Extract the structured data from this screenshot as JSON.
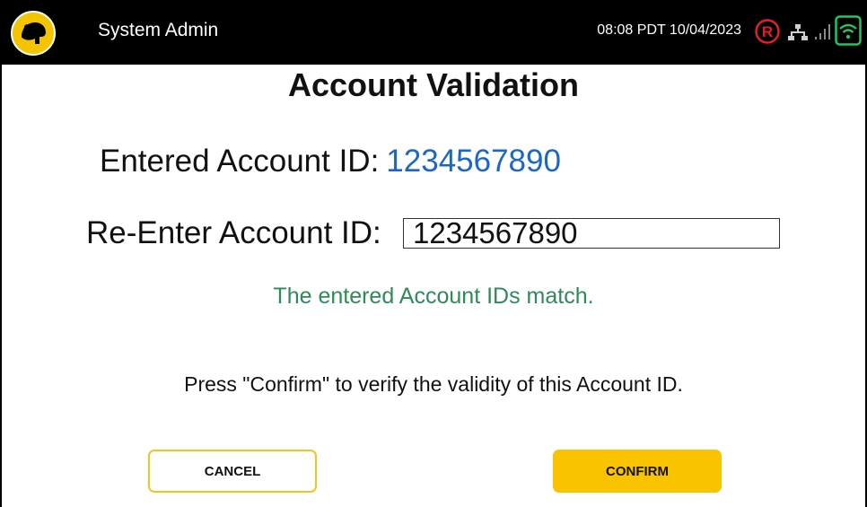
{
  "header": {
    "app_title": "System Admin",
    "datetime": "08:08 PDT  10/04/2023",
    "icons": [
      "dog-logo-icon",
      "registered-icon",
      "network-icon",
      "signal-icon",
      "wifi-icon"
    ],
    "logo_color": "#f5c400",
    "registered_color": "#e0202a",
    "wifi_color": "#22c55e"
  },
  "main": {
    "title": "Account Validation",
    "entered_label": "Entered Account ID:",
    "entered_value": "1234567890",
    "reenter_label": "Re-Enter Account ID:",
    "reenter_value": "1234567890",
    "match_message": "The entered Account IDs match.",
    "instruction": "Press \"Confirm\" to verify the validity of this Account ID."
  },
  "actions": {
    "cancel_label": "CANCEL",
    "confirm_label": "CONFIRM"
  },
  "colors": {
    "accent": "#fac300",
    "value_blue": "#1a66c9",
    "success_green": "#2e8b57"
  }
}
